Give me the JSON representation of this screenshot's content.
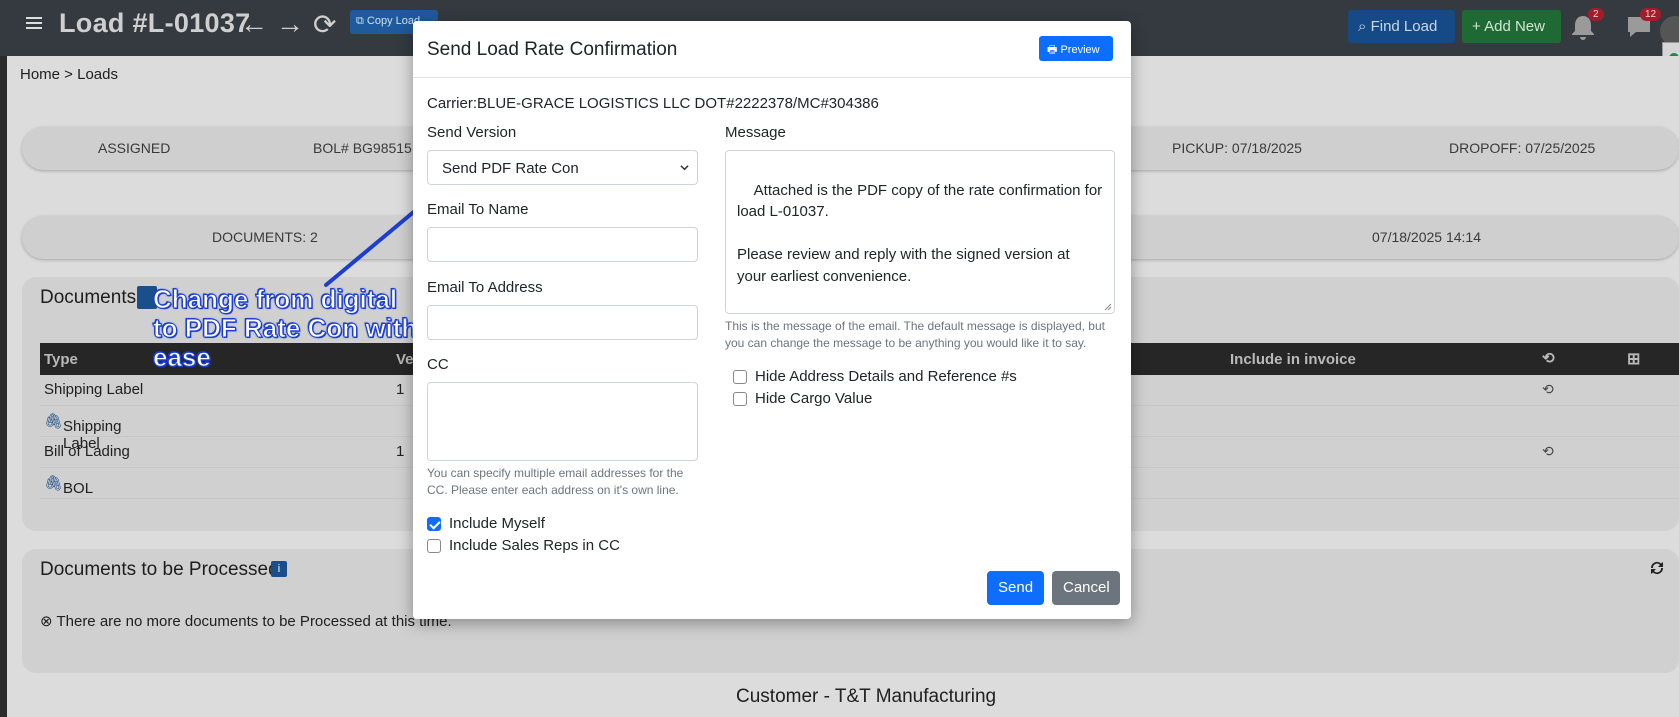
{
  "header": {
    "load_title": "Load #L-01037",
    "copy_load_label": "Copy Load",
    "find_load_label": "Find Load",
    "add_new_label": "Add New",
    "notifications_count": "2",
    "messages_count": "12"
  },
  "breadcrumb": "Home > Loads",
  "status_bar": {
    "status": "ASSIGNED",
    "bol": "BOL# BG98515",
    "pickup": "PICKUP: 07/18/2025",
    "dropoff": "DROPOFF: 07/25/2025"
  },
  "documents_bar": {
    "documents_count": "DOCUMENTS: 2",
    "timestamp": "07/18/2025 14:14"
  },
  "documents": {
    "title": "Documents",
    "columns": {
      "type": "Type",
      "version": "Ve",
      "include_in_invoice": "Include in invoice"
    },
    "rows": [
      {
        "type": "Shipping Label",
        "version": "1"
      },
      {
        "type": "Shipping Label",
        "version": ""
      },
      {
        "type": "Bill of Lading",
        "version": "1"
      },
      {
        "type": "BOL",
        "version": ""
      }
    ]
  },
  "documents_to_process": {
    "title": "Documents to be Processed",
    "empty_message": "There are no more documents to be Processed at this time."
  },
  "customer_title": "Customer - T&T Manufacturing",
  "annotation": {
    "text": "Change from digital to PDF Rate Con with ease",
    "color": "#1d3fd1"
  },
  "modal": {
    "title": "Send Load Rate Confirmation",
    "preview_label": "Preview",
    "carrier_line": "Carrier:BLUE-GRACE LOGISTICS LLC DOT#2222378/MC#304386",
    "send_version_label": "Send Version",
    "send_version_value": "Send PDF Rate Con",
    "email_to_name_label": "Email To Name",
    "email_to_name_value": "",
    "email_to_address_label": "Email To Address",
    "email_to_address_value": "",
    "cc_label": "CC",
    "cc_value": "",
    "cc_help": "You can specify multiple email addresses for the CC. Please enter each address on it's own line.",
    "message_label": "Message",
    "message_value": "Attached is the PDF copy of the rate confirmation for load L-01037.\n\nPlease review and reply with the signed version at your earliest convenience.\n\nLet me know if you have any questions.",
    "message_help": "This is the message of the email. The default message is displayed, but you can change the message to be anything you would like it to say.",
    "hide_address_label": "Hide Address Details and Reference #s",
    "hide_address_checked": false,
    "hide_cargo_label": "Hide Cargo Value",
    "hide_cargo_checked": false,
    "include_myself_label": "Include Myself",
    "include_myself_checked": true,
    "include_sales_reps_label": "Include Sales Reps in CC",
    "include_sales_reps_checked": false,
    "send_label": "Send",
    "cancel_label": "Cancel"
  },
  "colors": {
    "primary": "#0d6efd",
    "secondary": "#6c757d",
    "topbar": "#343a40"
  }
}
